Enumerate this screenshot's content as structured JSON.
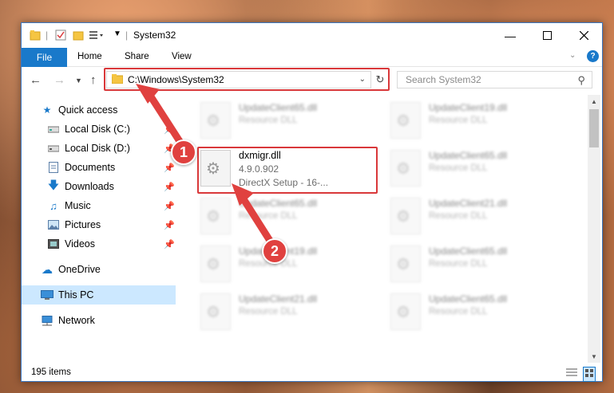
{
  "window": {
    "title": "System32",
    "tabs": {
      "file": "File",
      "home": "Home",
      "share": "Share",
      "view": "View"
    },
    "address": "C:\\Windows\\System32",
    "search_placeholder": "Search System32"
  },
  "sidebar": {
    "items": [
      {
        "label": "Quick access",
        "icon": "star-icon",
        "pinned": false
      },
      {
        "label": "Local Disk (C:)",
        "icon": "drive-icon",
        "pinned": true
      },
      {
        "label": "Local Disk (D:)",
        "icon": "drive-icon",
        "pinned": true
      },
      {
        "label": "Documents",
        "icon": "documents-icon",
        "pinned": true
      },
      {
        "label": "Downloads",
        "icon": "download-icon",
        "pinned": true
      },
      {
        "label": "Music",
        "icon": "music-icon",
        "pinned": true
      },
      {
        "label": "Pictures",
        "icon": "pictures-icon",
        "pinned": true
      },
      {
        "label": "Videos",
        "icon": "videos-icon",
        "pinned": true
      },
      {
        "label": "OneDrive",
        "icon": "cloud-icon",
        "pinned": false
      },
      {
        "label": "This PC",
        "icon": "computer-icon",
        "pinned": false,
        "selected": true
      },
      {
        "label": "Network",
        "icon": "network-icon",
        "pinned": false
      }
    ]
  },
  "files": {
    "selected": {
      "name": "dxmigr.dll",
      "version": "4.9.0.902",
      "description": "DirectX Setup - 16-..."
    },
    "left_column": [
      "UpdateClient65.dll",
      "UpdateClient65.dll",
      "UpdateClient19.dll",
      "UpdateClient21.dll"
    ],
    "right_column": [
      "UpdateClient19.dll",
      "UpdateClient65.dll",
      "UpdateClient21.dll",
      "UpdateClient65.dll",
      "UpdateClient65.dll"
    ],
    "type_label": "Resource DLL"
  },
  "status": {
    "item_count": "195 items"
  },
  "annotations": {
    "step1": "1",
    "step2": "2"
  },
  "colors": {
    "accent": "#1979ca",
    "highlight": "#d9383a",
    "selection": "#cce8ff"
  }
}
